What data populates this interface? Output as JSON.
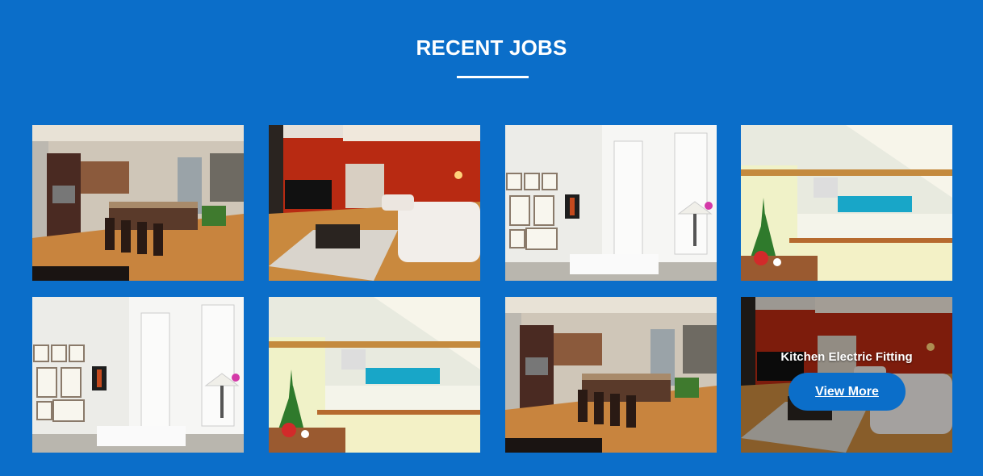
{
  "section": {
    "title": "RECENT JOBS"
  },
  "jobs": [
    {
      "scene": "kitchen-dark",
      "alt": "kitchen photo"
    },
    {
      "scene": "living-red",
      "alt": "living room photo"
    },
    {
      "scene": "white-room",
      "alt": "white room photo"
    },
    {
      "scene": "kitchen-teal",
      "alt": "kitchen photo"
    },
    {
      "scene": "white-room",
      "alt": "white room photo"
    },
    {
      "scene": "kitchen-teal",
      "alt": "kitchen photo"
    },
    {
      "scene": "kitchen-dark",
      "alt": "kitchen photo"
    },
    {
      "scene": "living-red",
      "alt": "living room photo"
    }
  ],
  "hover_card": {
    "title": "Kitchen Electric Fitting",
    "button_label": "View More"
  },
  "colors": {
    "background": "#0b6ec9",
    "accent": "#ffffff"
  }
}
